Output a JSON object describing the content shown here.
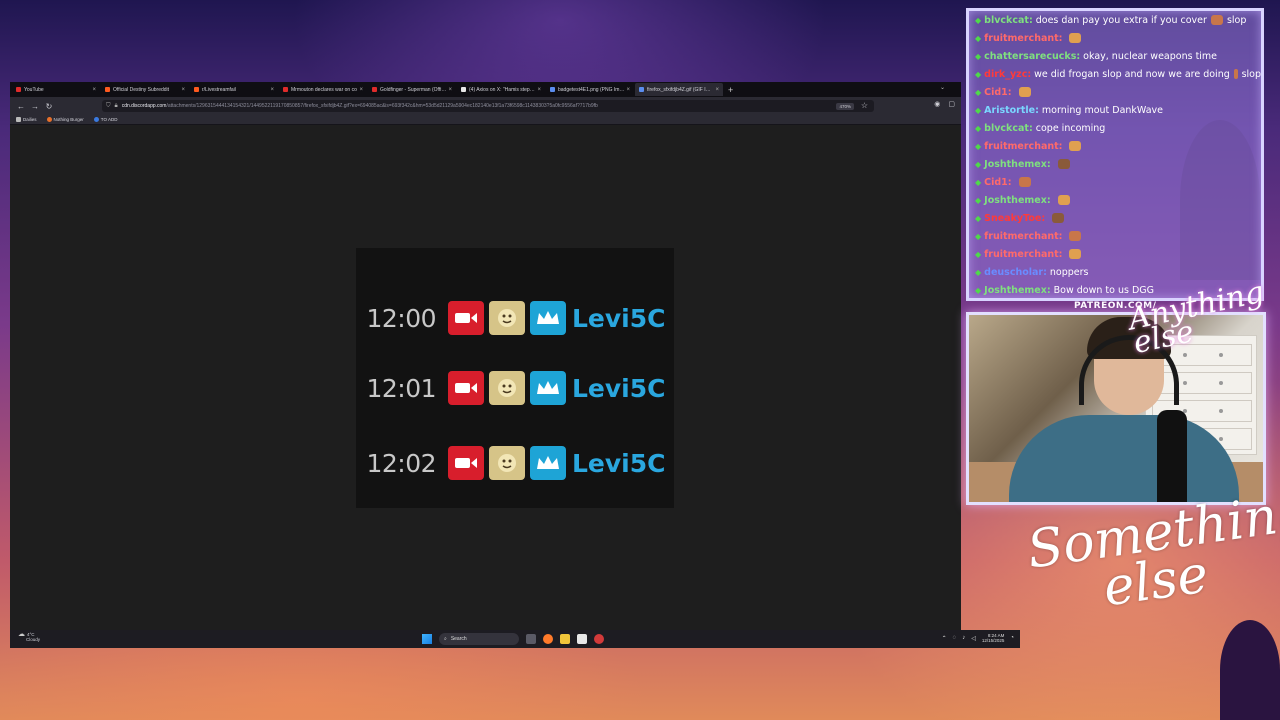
{
  "browser": {
    "tabs": [
      {
        "label": "YouTube",
        "color": "#e02b2b",
        "active": false
      },
      {
        "label": "Official Destiny Subreddit",
        "color": "#ff5a1f",
        "active": false
      },
      {
        "label": "r/Livestreamfail",
        "color": "#ff5a1f",
        "active": false
      },
      {
        "label": "Mrmouton declares war on co",
        "color": "#e02b2b",
        "active": false
      },
      {
        "label": "Goldfinger - Superman (Officia",
        "color": "#e02b2b",
        "active": false
      },
      {
        "label": "(4) Axios on X: \"Hamis stepping",
        "color": "#e8e8e8",
        "active": false
      },
      {
        "label": "badgetest4E1.png (PNG Image, 14",
        "color": "#5b8def",
        "active": false
      },
      {
        "label": "firefox_sfxifdjb4Z.gif (GIF Image, 1",
        "color": "#5b8def",
        "active": true
      }
    ],
    "url_domain": "cdn.discordapp.com",
    "url_path": "/attachments/1296315444134154321/1449522119170850857/firefox_sfxifdjb4Z.gif?ex=694085ac&is=693f342c&hm=53d5d21129a5904ec182140e13f1a73f6598c11438303?5a0fc9556af?717b9fb",
    "zoom": "470%",
    "bookmarks": [
      "Dailies",
      "Nothing Burger",
      "TO ADD"
    ]
  },
  "gif": {
    "rows": [
      {
        "time": "12:00",
        "user": "Levi5C"
      },
      {
        "time": "12:01",
        "user": "Levi5C"
      },
      {
        "time": "12:02",
        "user": "Levi5C"
      }
    ]
  },
  "taskbar": {
    "temp": "4°C",
    "weather": "Cloudy",
    "search_placeholder": "Search",
    "time": "8:24 AM",
    "date": "12/15/2025"
  },
  "chat": {
    "messages": [
      {
        "user": "blvckcat:",
        "color": "#7fe07f",
        "text": "does dan pay you extra if you cover",
        "suffix": "slop"
      },
      {
        "user": "fruitmerchant:",
        "color": "#ff6a6a",
        "text": "",
        "suffix": ""
      },
      {
        "user": "chattersarecucks:",
        "color": "#7fe07f",
        "text": "okay, nuclear weapons time",
        "suffix": ""
      },
      {
        "user": "dirk_yzc:",
        "color": "#ff3a3a",
        "text": "we did frogan slop and now we are doing",
        "suffix": "slop"
      },
      {
        "user": "Cid1:",
        "color": "#ff6a6a",
        "text": "",
        "suffix": ""
      },
      {
        "user": "Aristortle:",
        "color": "#7ad7ff",
        "text": "morning mout DankWave",
        "suffix": ""
      },
      {
        "user": "blvckcat:",
        "color": "#7fe07f",
        "text": "cope incoming",
        "suffix": ""
      },
      {
        "user": "fruitmerchant:",
        "color": "#ff6a6a",
        "text": "",
        "suffix": ""
      },
      {
        "user": "Joshthemex:",
        "color": "#7fe07f",
        "text": "",
        "suffix": ""
      },
      {
        "user": "Cid1:",
        "color": "#ff6a6a",
        "text": "",
        "suffix": ""
      },
      {
        "user": "Joshthemex:",
        "color": "#7fe07f",
        "text": "",
        "suffix": ""
      },
      {
        "user": "SneakyToe:",
        "color": "#ff3a3a",
        "text": "",
        "suffix": ""
      },
      {
        "user": "fruitmerchant:",
        "color": "#ff6a6a",
        "text": "",
        "suffix": ""
      },
      {
        "user": "fruitmerchant:",
        "color": "#ff6a6a",
        "text": "",
        "suffix": ""
      },
      {
        "user": "deuscholar:",
        "color": "#6a8cff",
        "text": "noppers",
        "suffix": ""
      },
      {
        "user": "Joshthemex:",
        "color": "#7fe07f",
        "text": "Bow down to us DGG",
        "suffix": ""
      }
    ]
  },
  "overlay": {
    "patreon": "PATREON.COM/",
    "cam_script": "Anything else",
    "big_script_line1": "Something",
    "big_script_line2": "else"
  }
}
